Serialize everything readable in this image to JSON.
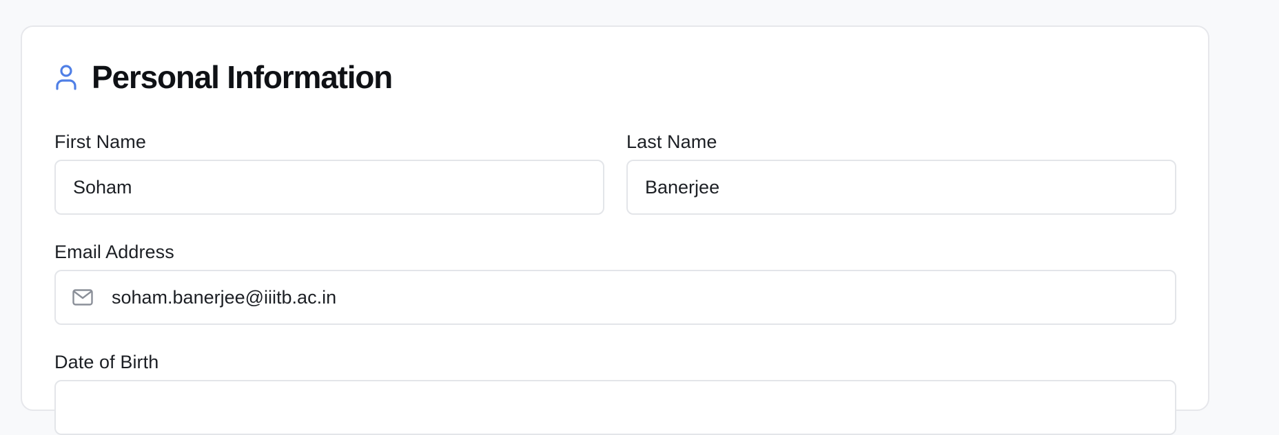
{
  "section": {
    "title": "Personal Information",
    "icon": "user-icon",
    "accent_color": "#4f7fe6"
  },
  "fields": {
    "first_name": {
      "label": "First Name",
      "value": "Soham"
    },
    "last_name": {
      "label": "Last Name",
      "value": "Banerjee"
    },
    "email": {
      "label": "Email Address",
      "value": "soham.banerjee@iiitb.ac.in",
      "icon": "mail-icon"
    },
    "dob": {
      "label": "Date of Birth",
      "value": ""
    }
  }
}
